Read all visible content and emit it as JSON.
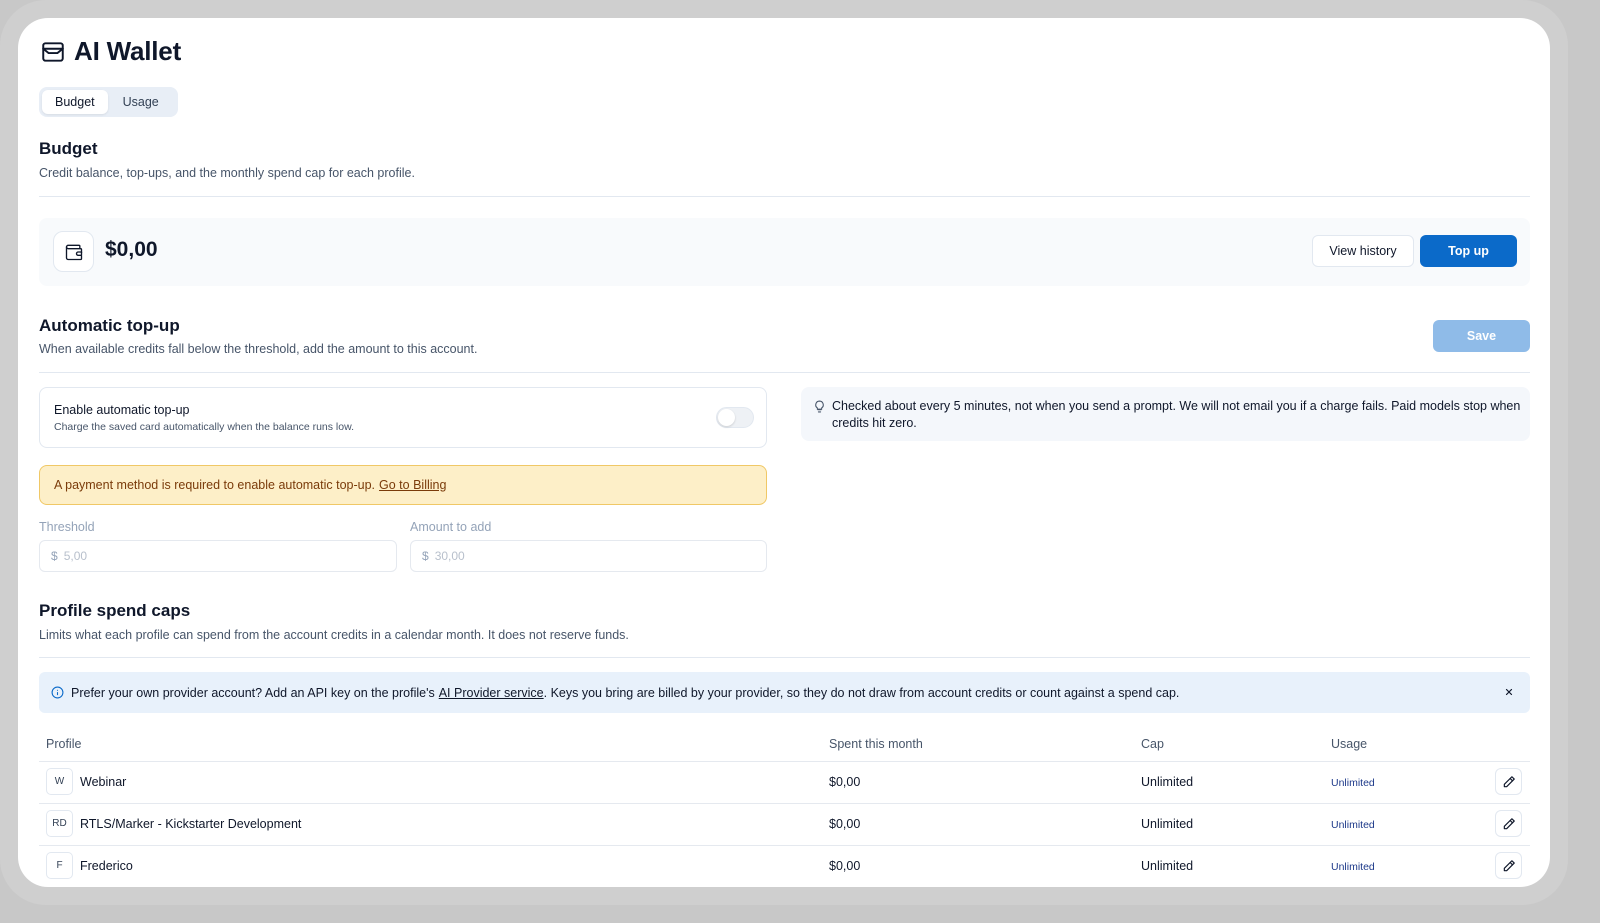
{
  "app": {
    "title": "AI Wallet",
    "tabs": [
      {
        "label": "Budget",
        "active": true
      },
      {
        "label": "Usage",
        "active": false
      }
    ]
  },
  "budget": {
    "heading": "Budget",
    "description": "Credit balance, top-ups, and the monthly spend cap for each profile.",
    "balance": "$0,00",
    "view_history_label": "View history",
    "top_up_label": "Top up"
  },
  "auto_topup": {
    "heading": "Automatic top-up",
    "description": "When available credits fall below the threshold, add the amount to this account.",
    "save_label": "Save",
    "toggle_title": "Enable automatic top-up",
    "toggle_desc": "Charge the saved card automatically when the balance runs low.",
    "toggle_on": false,
    "info_text": "Checked about every 5 minutes, not when you send a prompt. We will not email you if a charge fails. Paid models stop when credits hit zero.",
    "warning_text": "A payment method is required to enable automatic top-up.",
    "warning_link": "Go to Billing",
    "threshold_label": "Threshold",
    "threshold_currency": "$",
    "threshold_placeholder": "5,00",
    "amount_label": "Amount to add",
    "amount_currency": "$",
    "amount_placeholder": "30,00"
  },
  "caps": {
    "heading": "Profile spend caps",
    "description": "Limits what each profile can spend from the account credits in a calendar month. It does not reserve funds.",
    "notice_before": "Prefer your own provider account? Add an API key on the profile's",
    "notice_link": "AI Provider service",
    "notice_after": ". Keys you bring are billed by your provider, so they do not draw from account credits or count against a spend cap.",
    "columns": {
      "profile": "Profile",
      "spent": "Spent this month",
      "cap": "Cap",
      "usage": "Usage"
    },
    "rows": [
      {
        "initials": "W",
        "name": "Webinar",
        "spent": "$0,00",
        "cap": "Unlimited",
        "usage": "Unlimited"
      },
      {
        "initials": "RD",
        "name": "RTLS/Marker - Kickstarter Development",
        "spent": "$0,00",
        "cap": "Unlimited",
        "usage": "Unlimited"
      },
      {
        "initials": "F",
        "name": "Frederico",
        "spent": "$0,00",
        "cap": "Unlimited",
        "usage": "Unlimited"
      }
    ]
  },
  "colors": {
    "primary": "#0b6ac9",
    "primary_disabled": "#8fbbe8",
    "warning_bg": "#fdefc8",
    "notice_bg": "#e8f1fb"
  }
}
